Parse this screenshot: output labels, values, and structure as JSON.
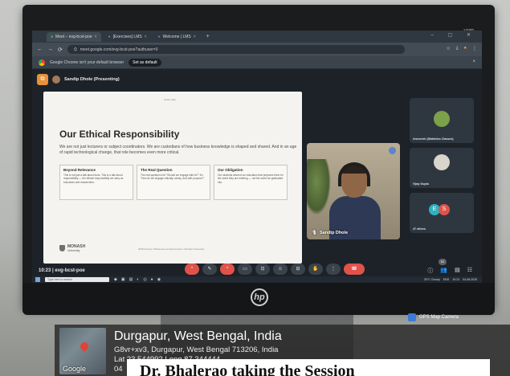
{
  "monitor": {
    "brand_tag": "V19D",
    "logo": "hp"
  },
  "browser": {
    "tabs": [
      {
        "label": "Meet – evg-bcst-poe",
        "active": true
      },
      {
        "label": "[Exercises] LMS",
        "active": false
      },
      {
        "label": "Welcome | LMS",
        "active": false
      }
    ],
    "url": "meet.google.com/evg-bcst-poe?authuser=0",
    "infobar_text": "Google Chrome isn't your default browser",
    "set_default_label": "Set as default"
  },
  "meet": {
    "presenter": "Sandip Dhole (Presenting)",
    "time_code": "10:23 | evg-bcst-poe",
    "speaker_name": "Sandip Dhole",
    "participants": [
      {
        "label": "Aruneesh (Statistics Classes)"
      },
      {
        "label": "Vijay Gupta"
      },
      {
        "label": "47 others"
      }
    ],
    "people_count": "51"
  },
  "slide": {
    "tag": "Guide slide",
    "title": "Our Ethical Responsibility",
    "subtitle": "We are not just lecturers or subject coordinators. We are custodians of how business knowledge is shaped and shared. And in an age of rapid technological change, that role becomes even more critical.",
    "cards": [
      {
        "heading": "Beyond Relevance",
        "body": "This is not just a talk about tools. This is a talk about responsibility — the ethical responsibility we carry as educators and researchers."
      },
      {
        "heading": "The Real Question",
        "body": "The real question isn't \"Should we engage with AI?\" It's \"How do we engage critically, wisely, and with purpose?\""
      },
      {
        "heading": "Our Obligation",
        "body": "Our students deserve an education that prepares them for the world they are entering — not the world we graduated into."
      }
    ],
    "logo_text": "MONASH",
    "logo_sub": "University",
    "footer": "2025 Faculty of Business and Economics • Monash University"
  },
  "taskbar": {
    "search_placeholder": "Type here to search",
    "weather": "30°C Cloudy",
    "tray_lang": "ENG",
    "clock": "10:23",
    "date": "04-08-2025"
  },
  "gps": {
    "camera_label": "GPS Map Camera",
    "place": "Durgapur, West Bengal, India",
    "address": "G8vr+xv3, Durgapur, West Bengal 713206, India",
    "lat_long": "Lat 23.544992 Long 87.344444",
    "date_prefix": "04",
    "map_brand": "Google"
  },
  "caption": "Dr. Bhalerao taking the Session"
}
